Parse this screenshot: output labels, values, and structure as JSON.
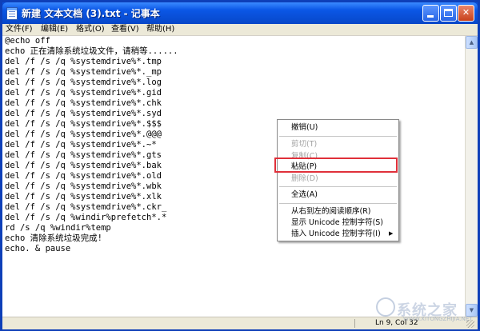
{
  "window": {
    "title": "新建 文本文档 (3).txt - 记事本",
    "minimize_glyph": "",
    "close_glyph": "✕"
  },
  "menu": {
    "items": [
      "文件(F)",
      "编辑(E)",
      "格式(O)",
      "查看(V)",
      "帮助(H)"
    ]
  },
  "editor": {
    "lines": [
      "@echo off",
      "echo 正在清除系统垃圾文件，请稍等......",
      "del /f /s /q %systemdrive%*.tmp",
      "del /f /s /q %systemdrive%*._mp",
      "del /f /s /q %systemdrive%*.log",
      "del /f /s /q %systemdrive%*.gid",
      "del /f /s /q %systemdrive%*.chk",
      "del /f /s /q %systemdrive%*.syd",
      "del /f /s /q %systemdrive%*.$$$",
      "del /f /s /q %systemdrive%*.@@@",
      "del /f /s /q %systemdrive%*.~*",
      "del /f /s /q %systemdrive%*.gts",
      "del /f /s /q %systemdrive%*.bak",
      "del /f /s /q %systemdrive%*.old",
      "del /f /s /q %systemdrive%*.wbk",
      "del /f /s /q %systemdrive%*.xlk",
      "del /f /s /q %systemdrive%*.ckr_",
      "del /f /s /q %windir%prefetch*.*",
      "rd /s /q %windir%temp",
      "echo 清除系统垃圾完成!",
      "echo. & pause"
    ]
  },
  "context_menu": {
    "items": [
      {
        "label": "撤销(U)",
        "enabled": true
      },
      {
        "label": "剪切(T)",
        "enabled": false
      },
      {
        "label": "复制(C)",
        "enabled": false
      },
      {
        "label": "粘贴(P)",
        "enabled": true,
        "highlighted": true
      },
      {
        "label": "删除(D)",
        "enabled": false
      },
      {
        "label": "全选(A)",
        "enabled": true
      },
      {
        "label": "从右到左的阅读顺序(R)",
        "enabled": true
      },
      {
        "label": "显示 Unicode 控制字符(S)",
        "enabled": true
      },
      {
        "label": "插入 Unicode 控制字符(I)",
        "enabled": true,
        "submenu": true
      }
    ],
    "submenu_arrow": "▶"
  },
  "statusbar": {
    "position": "Ln 9, Col 32"
  },
  "watermark": {
    "text": "系统之家",
    "url": "WWW.XITONGZHIJIA.NET"
  },
  "colors": {
    "titlebar": "#0b57e6",
    "highlight_box": "#e0303a",
    "disabled_text": "#a3a3a3"
  }
}
